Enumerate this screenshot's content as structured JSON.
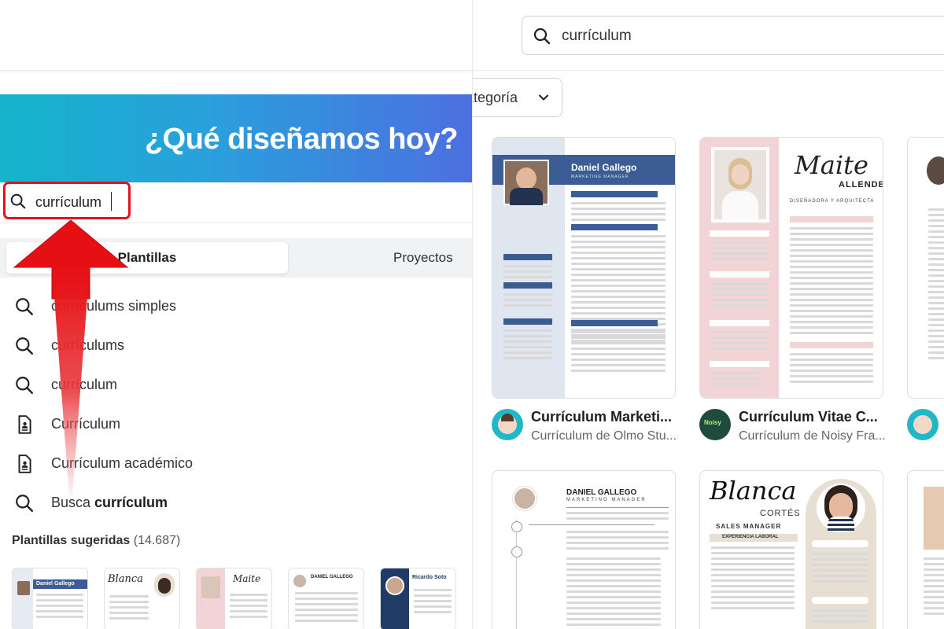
{
  "left": {
    "hero_title": "¿Qué diseñamos hoy?",
    "search": {
      "value": "currículum"
    },
    "tabs": [
      {
        "label": "Plantillas",
        "active": true
      },
      {
        "label": "Proyectos",
        "active": false
      }
    ],
    "suggestions": [
      {
        "icon": "search-icon",
        "text": "currículums simples",
        "bold": ""
      },
      {
        "icon": "search-icon",
        "text": "currículums",
        "bold": ""
      },
      {
        "icon": "search-icon",
        "text": "currículum",
        "bold": ""
      },
      {
        "icon": "document-icon",
        "text": "Currículum",
        "bold": ""
      },
      {
        "icon": "document-icon",
        "text": "Currículum académico",
        "bold": ""
      },
      {
        "icon": "search-icon",
        "text": "Busca ",
        "bold": "currículum"
      }
    ],
    "suggested": {
      "title": "Plantillas sugeridas",
      "count": "(14.687)"
    },
    "thumb_labels": [
      "Daniel Gallego",
      "Blanca",
      "Maite",
      "DANIEL GALLEGO",
      "Ricardo Soto"
    ]
  },
  "right": {
    "search": {
      "value": "currículum"
    },
    "category_button": "ategoría",
    "cards": [
      {
        "name": "Daniel Gallego",
        "role": "MARKETING MANAGER",
        "title": "Currículum Marketi...",
        "subtitle": "Currículum de Olmo Stu..."
      },
      {
        "name": "Maite",
        "surname": "ALLENDE",
        "role": "DISEÑADORA Y ARQUITECTA",
        "title": "Currículum Vitae C...",
        "subtitle": "Currículum de Noisy Fra...",
        "avatar_text": "Noisy Fra..."
      },
      {
        "name": "DANIEL GALLEGO",
        "role": "MARKETING MANAGER"
      },
      {
        "name": "Blanca",
        "surname": "CORTÉS",
        "role": "SALES MANAGER",
        "section": "EXPERIENCIA LABORAL"
      }
    ]
  },
  "colors": {
    "accent_red": "#e0141e",
    "hero_start": "#14b4cc",
    "hero_end": "#4d6fe0",
    "resume_blue": "#3b5c94",
    "resume_pink": "#f2d3d6",
    "resume_beige": "#e8dfd3"
  }
}
